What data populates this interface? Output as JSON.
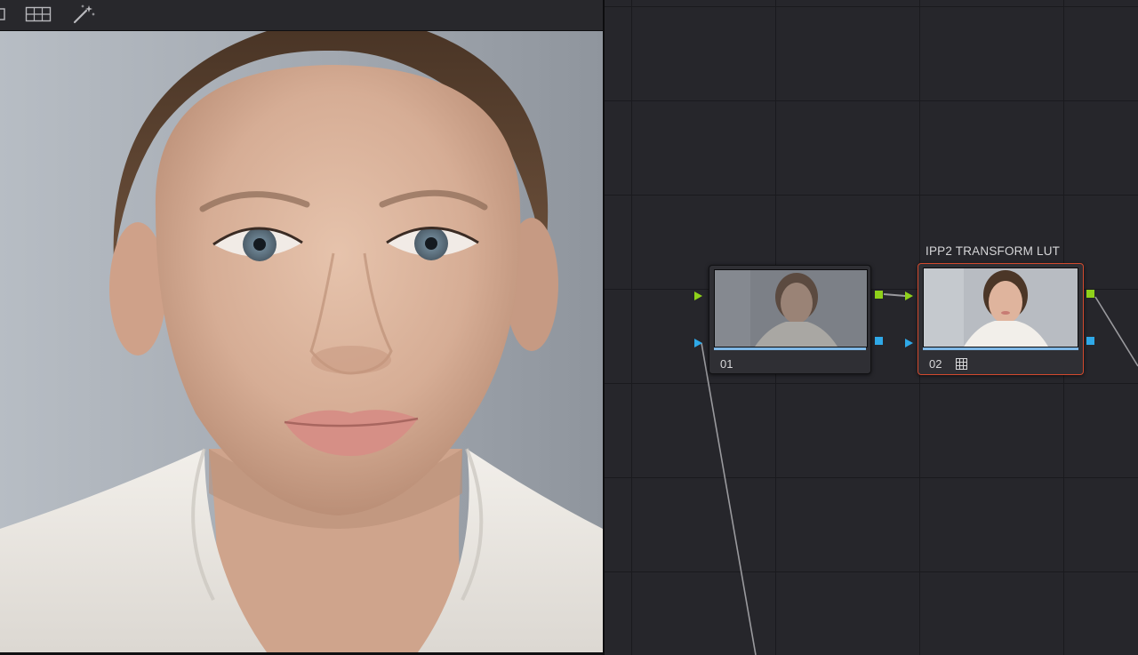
{
  "viewer": {
    "toolbar": {
      "icons": [
        "layout-single-icon",
        "split-screen-grid-icon",
        "magic-wand-icon"
      ]
    },
    "image": "portrait-frame"
  },
  "node_editor": {
    "colors": {
      "rgb_port": "#8fd11a",
      "key_port": "#2fa9e8",
      "selected_border": "#d24a2e",
      "wire": "#9a9a9e"
    },
    "nodes": [
      {
        "id": "01",
        "label": "",
        "selected": false,
        "has_lut": false
      },
      {
        "id": "02",
        "label": "IPP2 TRANSFORM LUT",
        "selected": true,
        "has_lut": true,
        "lut_icon": "grid-lut-icon"
      }
    ]
  }
}
